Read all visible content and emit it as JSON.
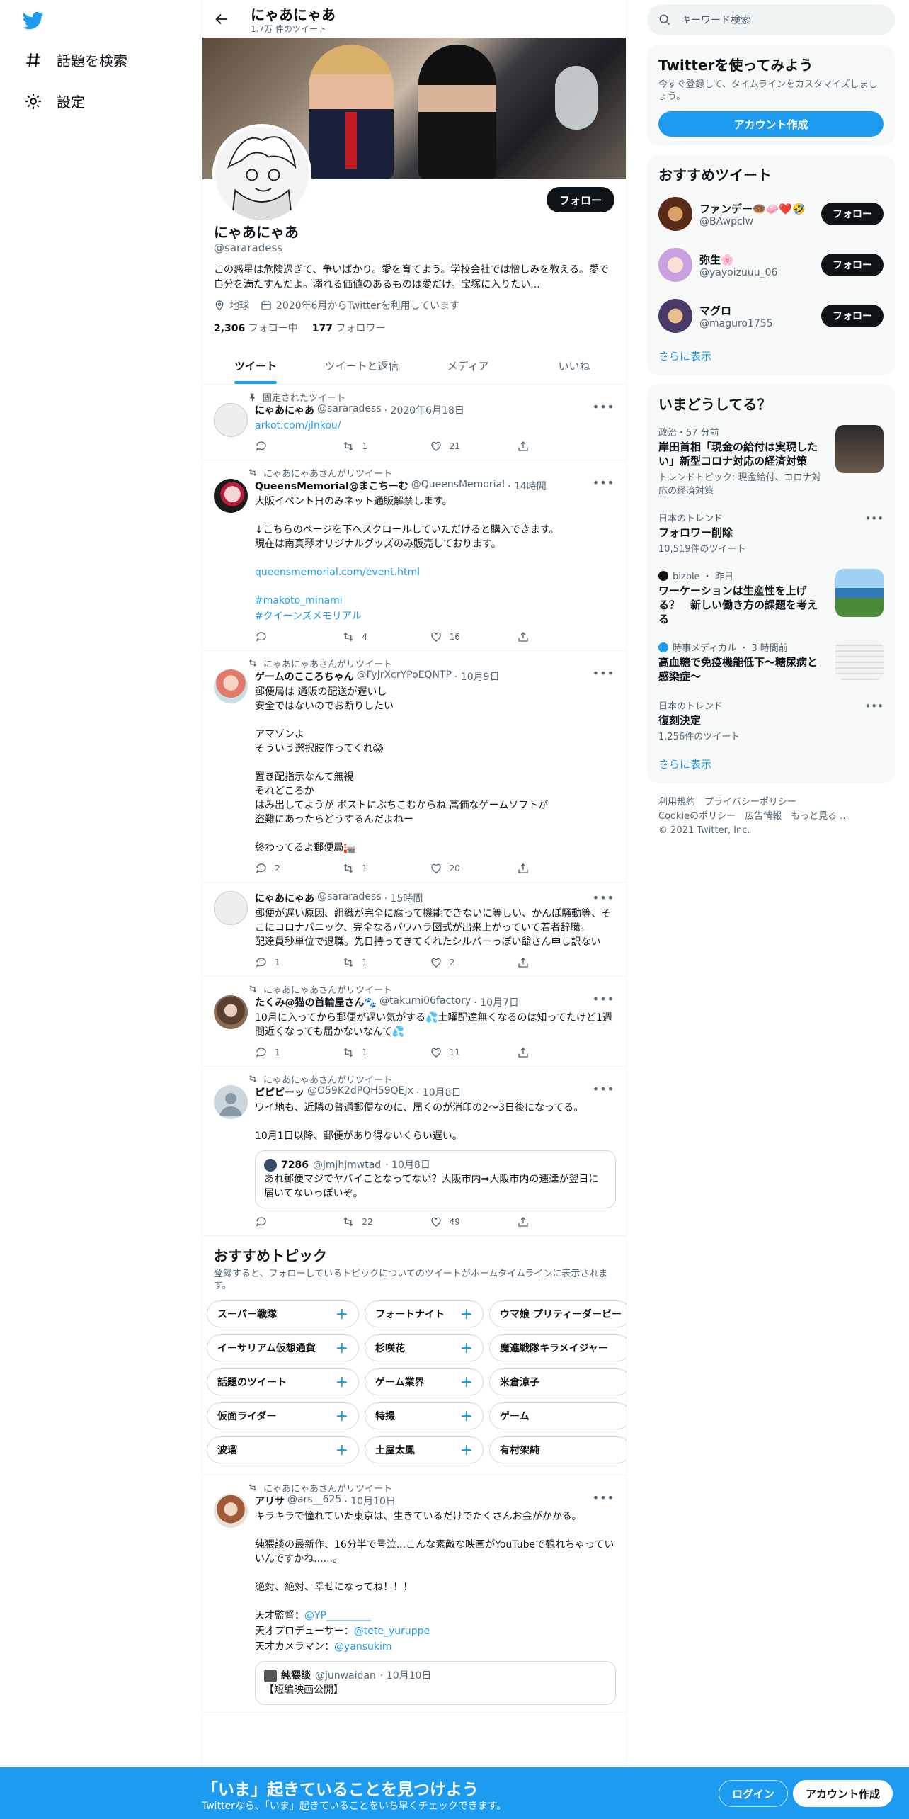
{
  "nav": {
    "explore_label": "話題を検索",
    "settings_label": "設定"
  },
  "header": {
    "title": "にゃあにゃあ",
    "subtitle": "1.7万 件のツイート"
  },
  "profile": {
    "name": "にゃあにゃあ",
    "handle": "@sararadess",
    "bio": "この惑星は危険過ぎて、争いばかり。愛を育てよう。学校会社では憎しみを教える。愛で自分を満たすんだよ。溺れる価値のあるものは愛だけ。宝塚に入りたい...",
    "location": "地球",
    "joined": "2020年6月からTwitterを利用しています",
    "following_count": "2,306",
    "following_label": "フォロー中",
    "followers_count": "177",
    "followers_label": "フォロワー",
    "follow_label": "フォロー"
  },
  "tabs": [
    "ツイート",
    "ツイートと返信",
    "メディア",
    "いいね"
  ],
  "tweets": [
    {
      "context": "固定されたツイート",
      "name": "にゃあにゃあ",
      "handle": "@sararadess",
      "time": "· 2020年6月18日",
      "text": "",
      "link": "arkot.com/jlnkou/",
      "replies": "",
      "retweets": "1",
      "likes": "21"
    },
    {
      "context": "にゃあにゃあさんがリツイート",
      "name": "QueensMemorial@まこちーむ",
      "handle": "@QueensMemorial",
      "time": "· 14時間",
      "text": "大阪イベント日のみネット通販解禁します。\n\n↓こちらのページを下へスクロールしていただけると購入できます。\n現在は南真琴オリジナルグッズのみ販売しております。",
      "link": "queensmemorial.com/event.html",
      "tag1": "#makoto_minami",
      "tag2": "#クイーンズメモリアル",
      "replies": "",
      "retweets": "4",
      "likes": "16"
    },
    {
      "context": "にゃあにゃあさんがリツイート",
      "name": "ゲームのこころちゃん",
      "handle": "@FyJrXcrYPoEQNTP",
      "time": "· 10月9日",
      "text": "郵便局は 通販の配送が遅いし\n安全ではないのでお断りしたい\n\nアマゾンよ\nそういう選択肢作ってくれ😱\n\n置き配指示なんて無視\nそれどころか\nはみ出してようが ポストにぶちこむからね 高価なゲームソフトが\n盗難にあったらどうするんだよねー\n\n終わってるよ郵便局🏣",
      "replies": "2",
      "retweets": "1",
      "likes": "20"
    },
    {
      "context": "",
      "name": "にゃあにゃあ",
      "handle": "@sararadess",
      "time": "· 15時間",
      "text": "郵便が遅い原因、組織が完全に腐って機能できないに等しい、かんぽ騒動等、そこにコロナパニック、完全なるパワハラ図式が出来上がっていて若者辞職。\n配達員秒単位で退職。先日持ってきてくれたシルバーっぽい爺さん申し訳ない",
      "replies": "1",
      "retweets": "1",
      "likes": "2"
    },
    {
      "context": "にゃあにゃあさんがリツイート",
      "name": "たくみ@猫の首輪屋さん🐾",
      "handle": "@takumi06factory",
      "time": "· 10月7日",
      "text": "10月に入ってから郵便が遅い気がする💦土曜配達無くなるのは知ってたけど1週間近くなっても届かないなんて💦",
      "replies": "1",
      "retweets": "1",
      "likes": "11"
    },
    {
      "context": "にゃあにゃあさんがリツイート",
      "name": "ピピピーッ",
      "handle": "@O59K2dPQH59QEJx",
      "time": "· 10月8日",
      "text": "ワイ地も、近隣の普通郵便なのに、届くのが消印の2〜3日後になってる。\n\n10月1日以降、郵便があり得ないくらい遅い。",
      "quote_name": "7286",
      "quote_handle": "@jmjhjmwtad",
      "quote_time": "· 10月8日",
      "quote_text": "あれ郵便マジでヤバイことなってない？大阪市内⇒大阪市内の速達が翌日に届いてないっぽいぞ。",
      "replies": "",
      "retweets": "22",
      "likes": "49"
    },
    {
      "context": "にゃあにゃあさんがリツイート",
      "name": "アリサ",
      "handle": "@ars__625",
      "time": "· 10月10日",
      "text": "キラキラで憧れていた東京は、生きているだけでたくさんお金がかかる。\n\n純猥談の最新作、16分半で号泣...こんな素敵な映画がYouTubeで観れちゃっていいんですかね......。\n\n絶対、絶対、幸せになってね！！！",
      "credit1_label": "天才監督：",
      "credit1_link": "@YP_________",
      "credit2_label": "天才プロデューサー：",
      "credit2_link": "@tete_yuruppe",
      "credit3_label": "天才カメラマン：",
      "credit3_link": "@yansukim",
      "quote_name": "純猥談",
      "quote_handle": "@junwaidan",
      "quote_time": "· 10月10日",
      "quote_text": "【短編映画公開】"
    }
  ],
  "topics": {
    "title": "おすすめトピック",
    "subtitle": "登録すると、フォローしているトピックについてのツイートがホームタイムラインに表示されます。",
    "chips": [
      "スーパー戦隊",
      "フォートナイト",
      "ウマ娘 プリティーダービー",
      "イーサリアム仮想通貨",
      "杉咲花",
      "魔進戦隊キラメイジャー",
      "話題のツイート",
      "ゲーム業界",
      "米倉涼子",
      "仮面ライダー",
      "特撮",
      "ゲーム",
      "波瑠",
      "土屋太鳳",
      "有村架純"
    ]
  },
  "right": {
    "search_placeholder": "キーワード検索",
    "signup_card": {
      "title": "Twitterを使ってみよう",
      "desc": "今すぐ登録して、タイムラインをカスタマイズしましょう。",
      "button": "アカウント作成"
    },
    "suggest": {
      "title": "おすすめツイート",
      "follow": "フォロー",
      "users": [
        {
          "name": "ファンデー🍩🧼❤️🤣",
          "handle": "@BAwpclw"
        },
        {
          "name": "弥生🌸",
          "handle": "@yayoizuuu_06"
        },
        {
          "name": "マグロ",
          "handle": "@maguro1755"
        }
      ],
      "more": "さらに表示"
    },
    "trends": {
      "title": "いまどうしてる？",
      "items": [
        {
          "cat": "政治・57 分前",
          "title": "岸田首相「現金の給付は実現したい」新型コロナ対応の経済対策",
          "extra": "トレンドトピック: 現金給付、コロナ対応の経済対策"
        },
        {
          "cat": "日本のトレンド",
          "title": "フォロワー削除",
          "count": "10,519件のツイート"
        },
        {
          "cat": "bizble ・ 昨日",
          "title": "ワーケーションは生産性を上げる？　新しい働き方の課題を考える"
        },
        {
          "cat": "時事メディカル ・ 3 時間前",
          "title": "高血糖で免疫機能低下～糖尿病と感染症～"
        },
        {
          "cat": "日本のトレンド",
          "title": "復刻決定",
          "count": "1,256件のツイート"
        }
      ],
      "more": "さらに表示"
    },
    "footer": {
      "line1": "利用規約　プライバシーポリシー",
      "line2": "Cookieのポリシー　広告情報　もっと見る ...",
      "line3": "© 2021 Twitter, Inc."
    }
  },
  "bottom": {
    "title": "「いま」起きていることを見つけよう",
    "subtitle": "Twitterなら、「いま」起きていることをいち早くチェックできます。",
    "login": "ログイン",
    "signup": "アカウント作成"
  },
  "colors": {
    "accent": "#1d9bf0",
    "text": "#0f1419",
    "muted": "#536471"
  }
}
